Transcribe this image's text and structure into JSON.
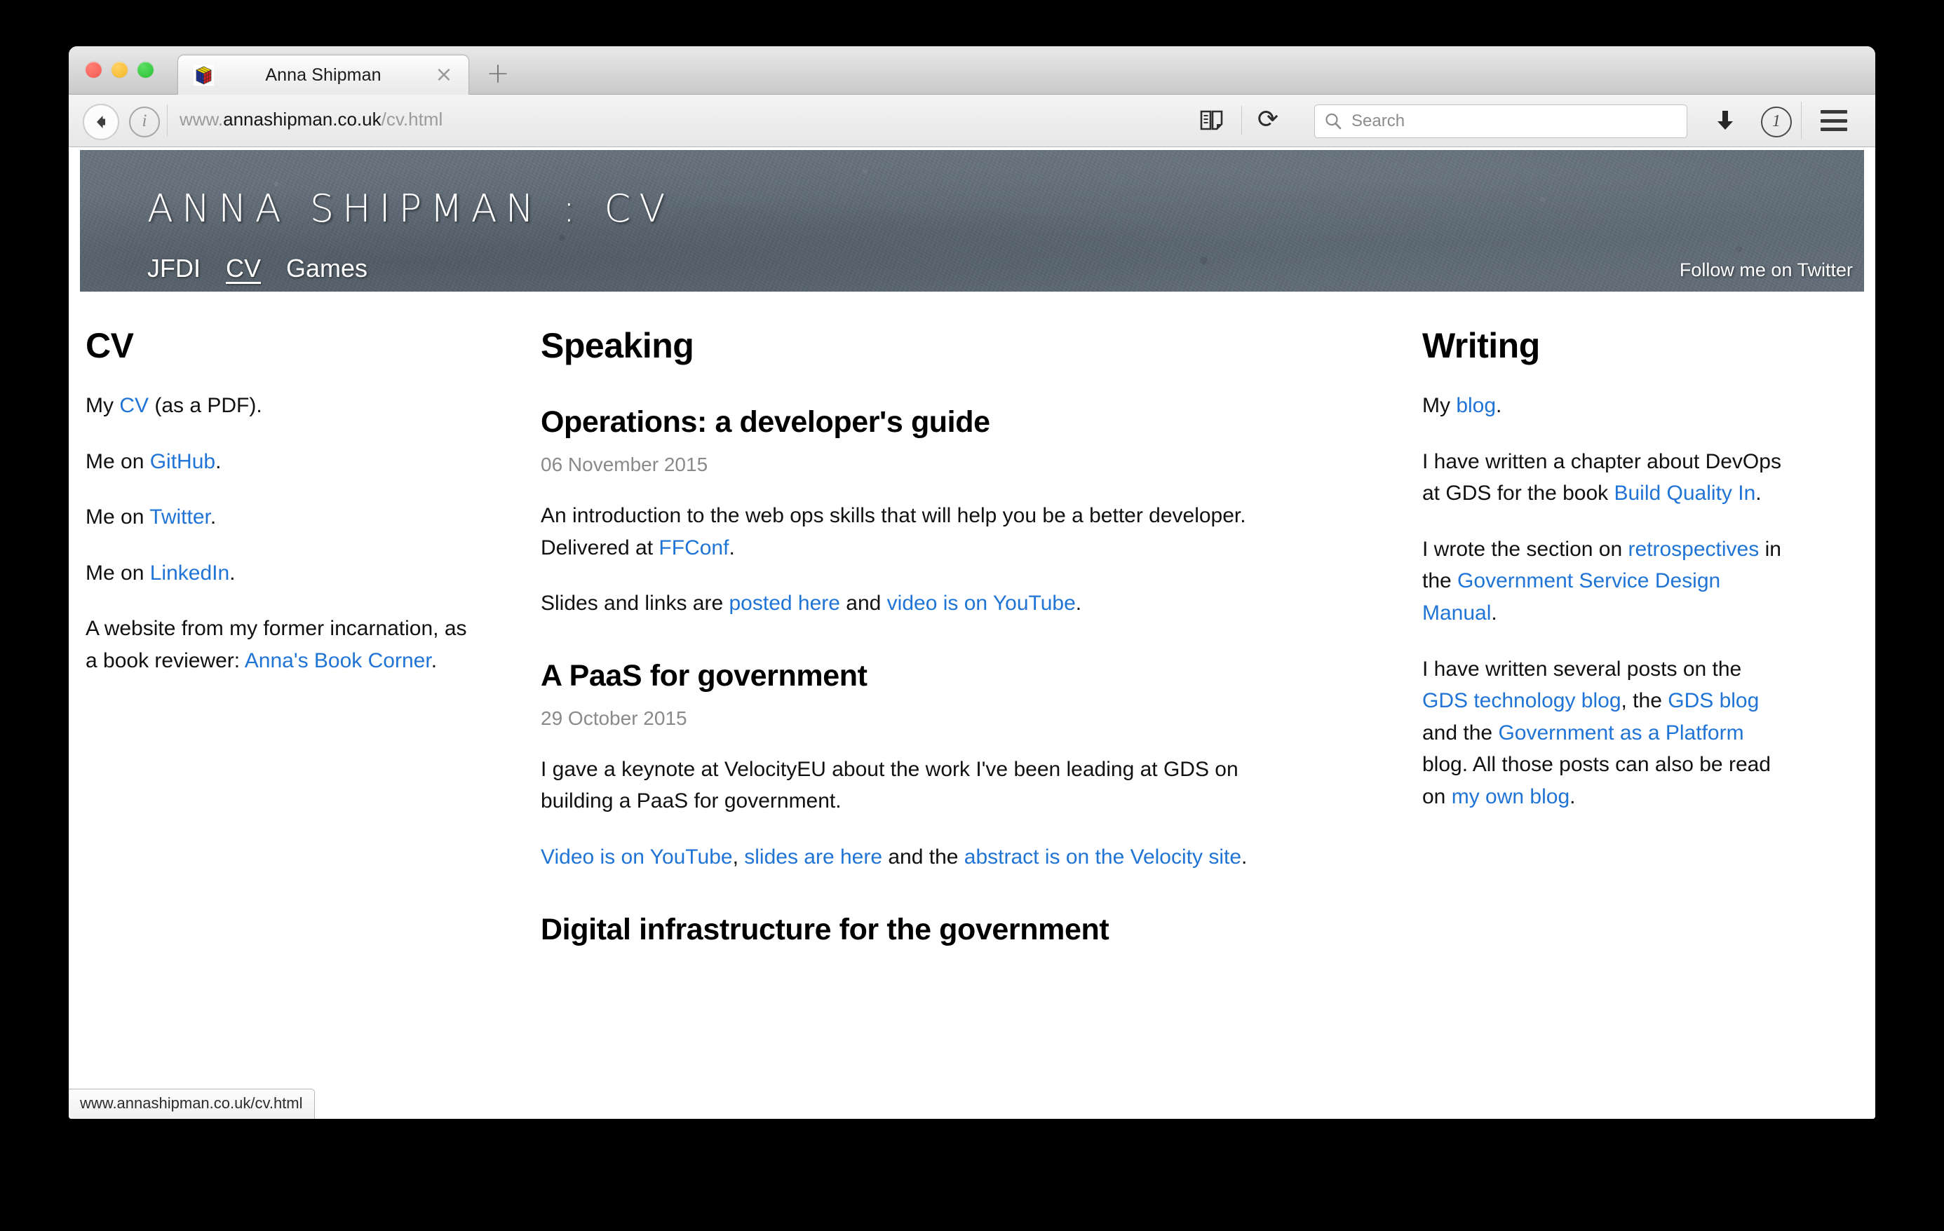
{
  "browser": {
    "tab_title": "Anna Shipman",
    "favicon": "rubiks-cube-icon",
    "close_label": "×",
    "new_tab_label": "+",
    "url_prefix": "www.",
    "url_domain": "annashipman.co.uk",
    "url_path": "/cv.html",
    "reload_label": "⟳",
    "search_placeholder": "Search",
    "status_bar_url": "www.annashipman.co.uk/cv.html"
  },
  "site": {
    "title": "ANNA SHIPMAN : CV",
    "nav": [
      {
        "label": "JFDI",
        "active": false
      },
      {
        "label": "CV",
        "active": true
      },
      {
        "label": "Games",
        "active": false
      }
    ],
    "twitter_label": "Follow me on Twitter"
  },
  "left_column": {
    "heading": "CV",
    "cv_line_pre": "My ",
    "cv_link": "CV",
    "cv_line_post": " (as a PDF).",
    "github_pre": "Me on ",
    "github_link": "GitHub",
    "github_post": ".",
    "twitter_pre": "Me on ",
    "twitter_link": "Twitter",
    "twitter_post": ".",
    "linkedin_pre": "Me on ",
    "linkedin_link": "LinkedIn",
    "linkedin_post": ".",
    "former_pre": "A website from my former incarnation, as a book reviewer: ",
    "former_link": "Anna's Book Corner",
    "former_post": "."
  },
  "middle_column": {
    "heading": "Speaking",
    "talks": [
      {
        "title": "Operations: a developer's guide",
        "date": "06 November 2015",
        "desc_pre": "An introduction to the web ops skills that will help you be a better developer. Delivered at ",
        "desc_link": "FFConf",
        "desc_post": ".",
        "links_pre": "Slides and links are ",
        "link1": "posted here",
        "links_mid": " and ",
        "link2": "video is on YouTube",
        "links_post": "."
      },
      {
        "title": "A PaaS for government",
        "date": "29 October 2015",
        "desc": "I gave a keynote at VelocityEU about the work I've been leading at GDS on building a PaaS for government.",
        "link1": "Video is on YouTube",
        "links_sep1": ", ",
        "link2": "slides are here",
        "links_mid": " and the ",
        "link3": "abstract is on the Velocity site",
        "links_post": "."
      },
      {
        "title": "Digital infrastructure for the government"
      }
    ]
  },
  "right_column": {
    "heading": "Writing",
    "blog_pre": "My ",
    "blog_link": "blog",
    "blog_post": ".",
    "chapter_pre": "I have written a chapter about DevOps at GDS for the book ",
    "chapter_link": "Build Quality In",
    "chapter_post": ".",
    "section_pre": "I wrote the section on ",
    "section_link1": "retrospectives",
    "section_mid": " in the ",
    "section_link2": "Government Service Design Manual",
    "section_post": ".",
    "posts_pre": "I have written several posts on the ",
    "posts_link1": "GDS technology blog",
    "posts_mid1": ", the ",
    "posts_link2": "GDS blog",
    "posts_mid2": " and the ",
    "posts_link3": "Government as a Platform",
    "posts_mid3": " blog. All those posts can also be read on ",
    "posts_link4": "my own blog",
    "posts_post": "."
  },
  "colors": {
    "link": "#1f74d6",
    "banner": "#626d78",
    "date_text": "#8a8a8a"
  }
}
